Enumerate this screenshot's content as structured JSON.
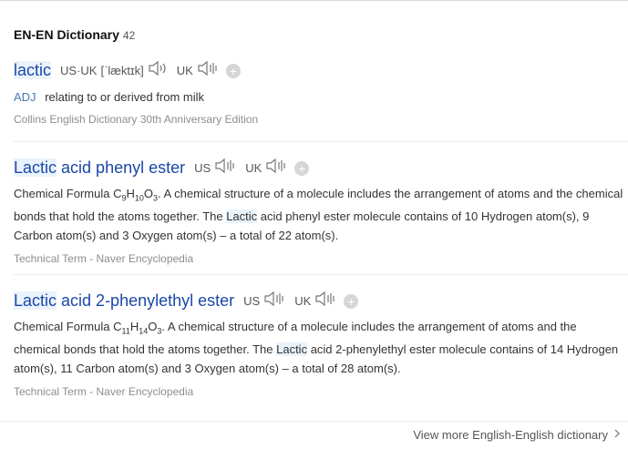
{
  "header": {
    "title": "EN-EN Dictionary",
    "count": "42"
  },
  "entries": [
    {
      "word": "lactic",
      "pron_label": "US·UK",
      "ipa": "[ˈlæktɪk]",
      "uk_label": "UK",
      "pos": "ADJ",
      "definition": "relating to or derived from milk",
      "source": "Collins English Dictionary 30th Anniversary Edition"
    },
    {
      "word_hl": "Lactic",
      "word_rest": " acid phenyl ester",
      "us_label": "US",
      "uk_label": "UK",
      "def_pre": "Chemical Formula C",
      "sub1": "9",
      "h": "H",
      "sub2": "10",
      "o": "O",
      "sub3": "3",
      "def_mid": ". A chemical structure of a molecule includes the arrangement of atoms and the chemical bonds that hold the atoms together. The ",
      "def_hl": "Lactic",
      "def_post": " acid phenyl ester molecule contains of 10 Hydrogen atom(s), 9 Carbon atom(s) and 3 Oxygen atom(s) – a total of 22 atom(s).",
      "source": "Technical Term - Naver Encyclopedia"
    },
    {
      "word_hl": "Lactic",
      "word_rest": " acid 2-phenylethyl ester",
      "us_label": "US",
      "uk_label": "UK",
      "def_pre": "Chemical Formula C",
      "sub1": "11",
      "h": "H",
      "sub2": "14",
      "o": "O",
      "sub3": "3",
      "def_mid": ". A chemical structure of a molecule includes the arrangement of atoms and the chemical bonds that hold the atoms together. The ",
      "def_hl": "Lactic",
      "def_post": " acid 2-phenylethyl ester molecule contains of 14 Hydrogen atom(s), 11 Carbon atom(s) and 3 Oxygen atom(s) – a total of 28 atom(s).",
      "source": "Technical Term - Naver Encyclopedia"
    }
  ],
  "footer": {
    "more_label": "View more English-English dictionary"
  },
  "icons": {
    "speaker": "speaker-icon",
    "add": "add-wordbook-icon",
    "more": "chevron-right-icon"
  },
  "colors": {
    "link": "#1a48a8",
    "highlight": "#eaf3fb",
    "pos": "#4a77b4"
  }
}
